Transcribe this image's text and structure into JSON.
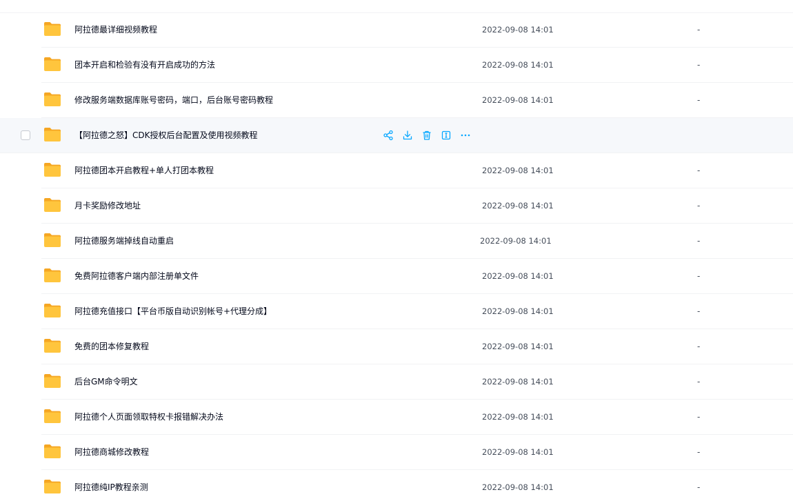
{
  "colors": {
    "folder": "#ffc53d",
    "folder_back": "#f5a623",
    "action_icon": "#06a7ff",
    "row_hover_bg": "#f6f8fb",
    "divider": "#f1f2f4"
  },
  "files": [
    {
      "name": "阿拉德最详细视频教程",
      "time": "2022-09-08 14:01",
      "size": "-",
      "icon": "folder-icon"
    },
    {
      "name": "团本开启和检验有没有开启成功的方法",
      "time": "2022-09-08 14:01",
      "size": "-",
      "icon": "folder-icon"
    },
    {
      "name": "修改服务端数据库账号密码，端口，后台账号密码教程",
      "time": "2022-09-08 14:01",
      "size": "-",
      "icon": "folder-icon"
    },
    {
      "name": "【阿拉德之怒】CDK授权后台配置及使用视频教程",
      "time": "",
      "size": "",
      "icon": "folder-icon",
      "hovered": true
    },
    {
      "name": "阿拉德团本开启教程+单人打团本教程",
      "time": "2022-09-08 14:01",
      "size": "-",
      "icon": "folder-icon"
    },
    {
      "name": "月卡奖励修改地址",
      "time": "2022-09-08 14:01",
      "size": "-",
      "icon": "folder-icon"
    },
    {
      "name": "阿拉德服务端掉线自动重启",
      "time": "2022-09-08 14:01",
      "size": "-",
      "icon": "folder-icon"
    },
    {
      "name": "免费阿拉德客户端内部注册单文件",
      "time": "2022-09-08 14:01",
      "size": "-",
      "icon": "folder-icon"
    },
    {
      "name": "阿拉德充值接口【平台币版自动识别帐号+代理分成】",
      "time": "2022-09-08 14:01",
      "size": "-",
      "icon": "folder-icon"
    },
    {
      "name": "免费的团本修复教程",
      "time": "2022-09-08 14:01",
      "size": "-",
      "icon": "folder-icon"
    },
    {
      "name": "后台GM命令明文",
      "time": "2022-09-08 14:01",
      "size": "-",
      "icon": "folder-icon"
    },
    {
      "name": "阿拉德个人页面领取特权卡报错解决办法",
      "time": "2022-09-08 14:01",
      "size": "-",
      "icon": "folder-icon"
    },
    {
      "name": "阿拉德商城修改教程",
      "time": "2022-09-08 14:01",
      "size": "-",
      "icon": "folder-icon"
    },
    {
      "name": "阿拉德纯IP教程亲测",
      "time": "2022-09-08 14:01",
      "size": "-",
      "icon": "folder-icon"
    }
  ],
  "hover_actions": [
    {
      "icon": "share-icon"
    },
    {
      "icon": "download-icon"
    },
    {
      "icon": "delete-icon"
    },
    {
      "icon": "rename-icon"
    },
    {
      "icon": "more-icon"
    }
  ]
}
